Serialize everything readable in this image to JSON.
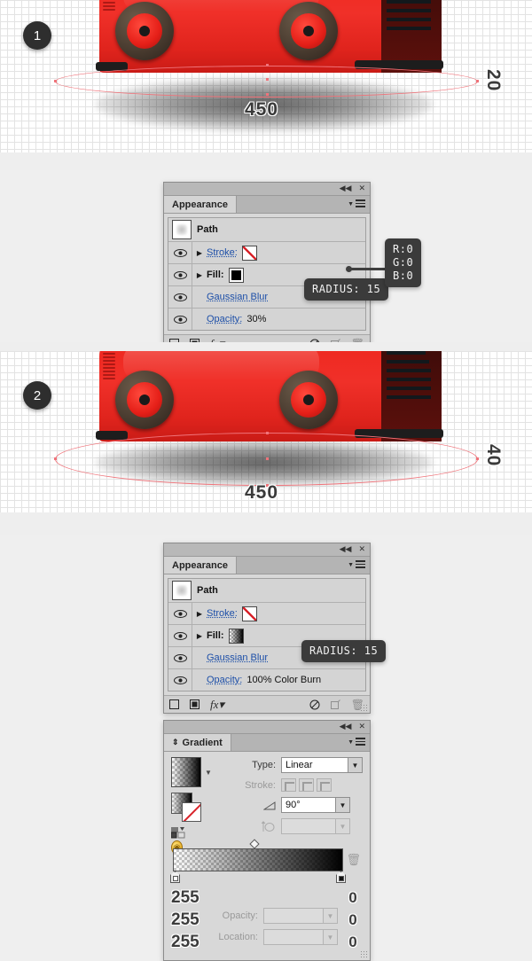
{
  "tutorial": {
    "steps": [
      {
        "badge": "1",
        "width_label": "450",
        "height_label": "20"
      },
      {
        "badge": "2",
        "width_label": "450",
        "height_label": "40"
      }
    ]
  },
  "appearance_panel_1": {
    "tab_label": "Appearance",
    "collapse_icon": "◀◀",
    "close_icon": "✕",
    "menu_icon": "panel-menu-icon",
    "path_label": "Path",
    "rows": [
      {
        "label": "Stroke:",
        "value": "",
        "swatch": "none"
      },
      {
        "label": "Fill:",
        "value": "",
        "swatch": "black"
      },
      {
        "label": "Gaussian Blur",
        "value": "",
        "swatch": ""
      },
      {
        "label": "Opacity:",
        "value": "30%",
        "swatch": ""
      }
    ],
    "footer_icons": [
      "add-new-stroke",
      "add-new-fill",
      "add-new-effect",
      "clear-appearance",
      "duplicate-item",
      "delete-item"
    ],
    "tooltip_radius": "RADIUS: 15",
    "tooltip_rgb": "R:0\nG:0\nB:0"
  },
  "appearance_panel_2": {
    "tab_label": "Appearance",
    "collapse_icon": "◀◀",
    "close_icon": "✕",
    "path_label": "Path",
    "rows": [
      {
        "label": "Stroke:",
        "value": "",
        "swatch": "none"
      },
      {
        "label": "Fill:",
        "value": "",
        "swatch": "grad"
      },
      {
        "label": "Gaussian Blur",
        "value": "",
        "swatch": ""
      },
      {
        "label": "Opacity:",
        "value": "100% Color Burn",
        "swatch": ""
      }
    ],
    "tooltip_radius": "RADIUS: 15"
  },
  "gradient_panel": {
    "tab_label": "Gradient",
    "tab_caret": "⇕",
    "collapse_icon": "◀◀",
    "close_icon": "✕",
    "type_label": "Type:",
    "type_value": "Linear",
    "stroke_label": "Stroke:",
    "angle_value": "90°",
    "aspect_value": "",
    "opacity_label": "Opacity:",
    "opacity_value": "",
    "location_label": "Location:",
    "location_value": "",
    "left_stop_rgb": [
      "255",
      "255",
      "255"
    ],
    "right_stop_rgb": [
      "0",
      "0",
      "0"
    ],
    "delete_stop_icon": "trash-icon"
  },
  "colors": {
    "bus_red": "#ef2a22",
    "panel_bg": "#d4d4d4",
    "link_blue": "#1d4fa8",
    "tooltip_bg": "#3b3b3b",
    "selection_pink": "#f0737a",
    "badge_dark": "#2e2e2e"
  }
}
